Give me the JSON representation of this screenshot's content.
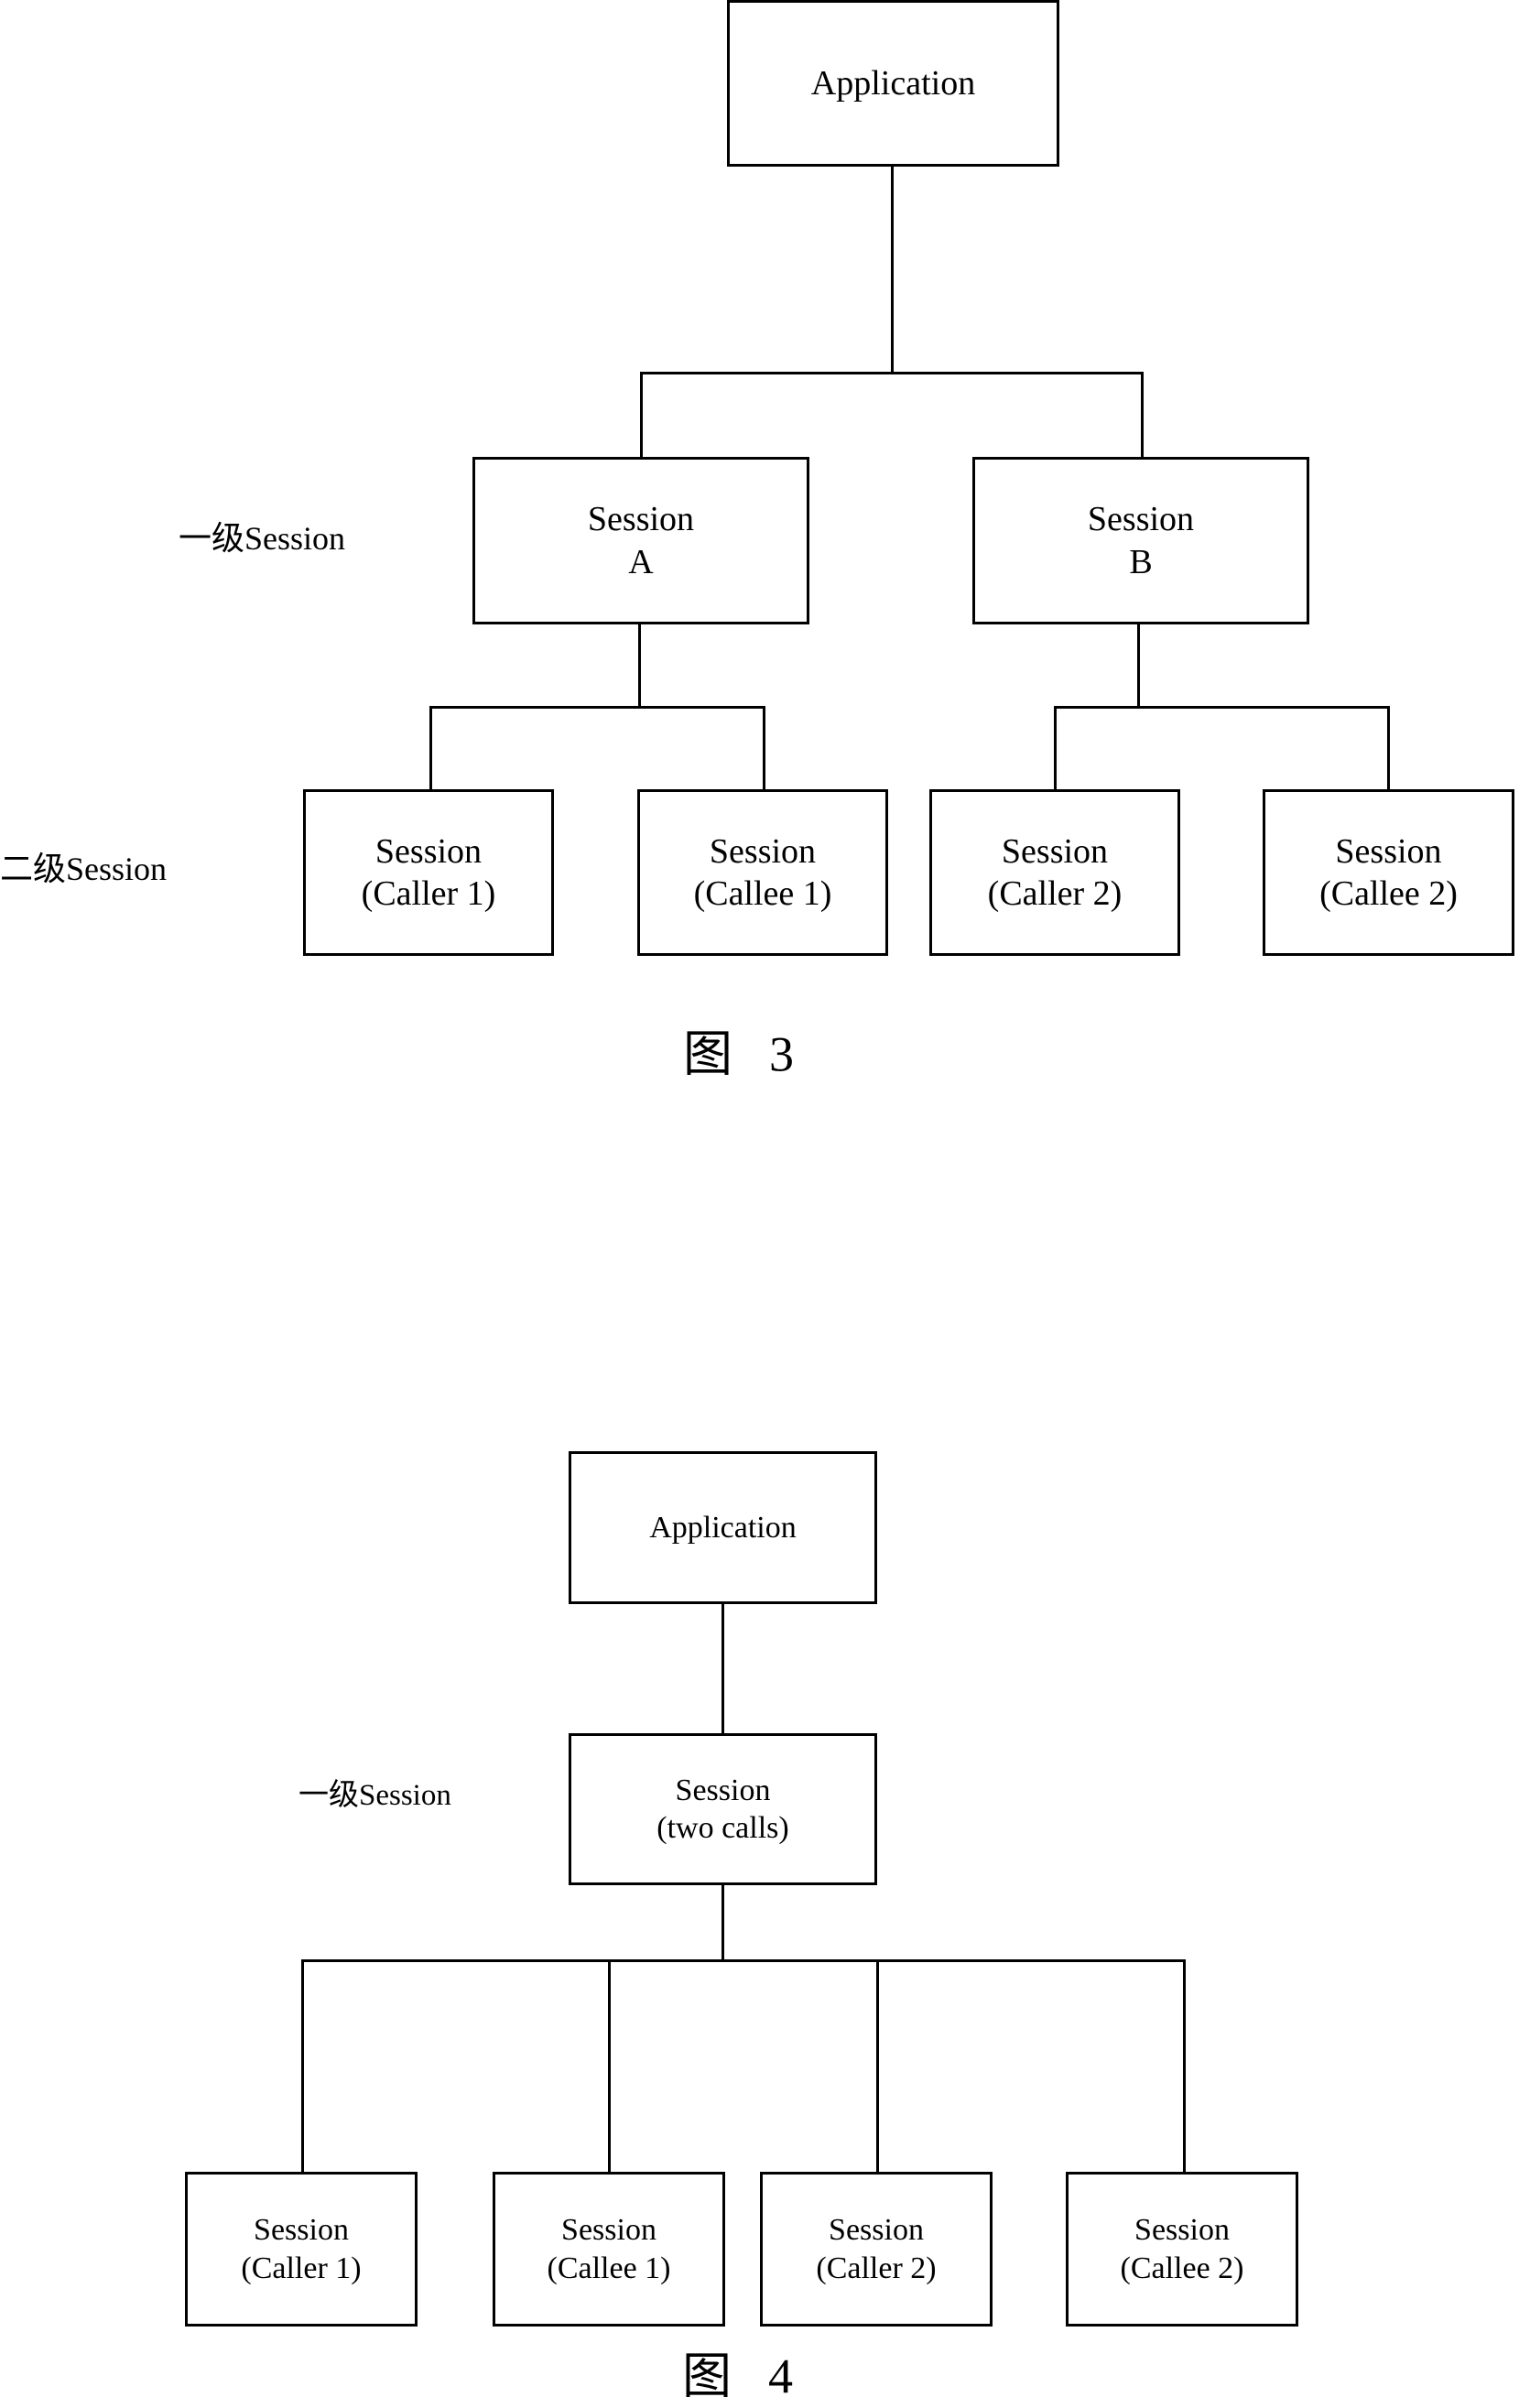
{
  "figure3": {
    "root": {
      "line1": "Application"
    },
    "level1_label": "一级Session",
    "level2_label": "二级Session",
    "level1": [
      {
        "line1": "Session",
        "line2": "A"
      },
      {
        "line1": "Session",
        "line2": "B"
      }
    ],
    "level2": [
      {
        "line1": "Session",
        "line2": "(Caller 1)"
      },
      {
        "line1": "Session",
        "line2": "(Callee 1)"
      },
      {
        "line1": "Session",
        "line2": "(Caller 2)"
      },
      {
        "line1": "Session",
        "line2": "(Callee 2)"
      }
    ],
    "caption": {
      "prefix": "图",
      "number": "3"
    }
  },
  "figure4": {
    "root": {
      "line1": "Application"
    },
    "level1_label": "一级Session",
    "level1": {
      "line1": "Session",
      "line2": "(two calls)"
    },
    "level2": [
      {
        "line1": "Session",
        "line2": "(Caller 1)"
      },
      {
        "line1": "Session",
        "line2": "(Callee 1)"
      },
      {
        "line1": "Session",
        "line2": "(Caller 2)"
      },
      {
        "line1": "Session",
        "line2": "(Callee 2)"
      }
    ],
    "caption": {
      "prefix": "图",
      "number": "4"
    }
  }
}
